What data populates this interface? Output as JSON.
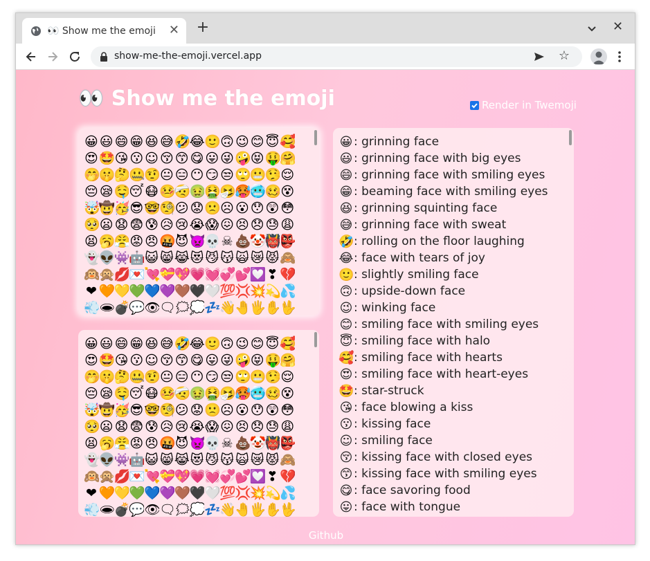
{
  "browser": {
    "tab_title": "👀 Show me the emoji",
    "url": "show-me-the-emoji.vercel.app"
  },
  "page": {
    "title": "👀 Show me the emoji",
    "twemoji_label": "Render in Twemoji",
    "twemoji_checked": true,
    "footer_link": "Github"
  },
  "native_emoji_grid": [
    "😀",
    "😃",
    "😄",
    "😁",
    "😆",
    "😅",
    "🤣",
    "😂",
    "🙂",
    "🙃",
    "😉",
    "😊",
    "😇",
    "🥰",
    "😍",
    "🤩",
    "😘",
    "😗",
    "☺",
    "😚",
    "😙",
    "😋",
    "😛",
    "😜",
    "🤪",
    "😝",
    "🤑",
    "🤗",
    "🤭",
    "🤫",
    "🤔",
    "🤐",
    "🤨",
    "😐",
    "😑",
    "😶",
    "😏",
    "😒",
    "🙄",
    "😬",
    "🤥",
    "😌",
    "😔",
    "😪",
    "🤤",
    "😴",
    "😷",
    "🤒",
    "🤕",
    "🤢",
    "🤮",
    "🤧",
    "🥵",
    "🥶",
    "🥴",
    "😵",
    "🤯",
    "🤠",
    "🥳",
    "😎",
    "🤓",
    "🧐",
    "😕",
    "😟",
    "🙁",
    "☹",
    "😮",
    "😯",
    "😲",
    "😳",
    "🥺",
    "😦",
    "😧",
    "😨",
    "😰",
    "😥",
    "😢",
    "😭",
    "😱",
    "😖",
    "😣",
    "😞",
    "😓",
    "😩",
    "😫",
    "🥱",
    "😤",
    "😡",
    "😠",
    "🤬",
    "😈",
    "👿",
    "💀",
    "☠",
    "💩",
    "🤡",
    "👹",
    "👺",
    "👻",
    "👽",
    "👾",
    "🤖",
    "😺",
    "😸",
    "😹",
    "😻",
    "😼",
    "😽",
    "🙀",
    "😿",
    "😾",
    "🙈",
    "🙉",
    "🙊",
    "💋",
    "💌",
    "💘",
    "💝",
    "💖",
    "💗",
    "💓",
    "💞",
    "💕",
    "💟",
    "❣",
    "💔",
    "❤",
    "🧡",
    "💛",
    "💚",
    "💙",
    "💜",
    "🤎",
    "🖤",
    "🤍",
    "💯",
    "💢",
    "💥",
    "💫",
    "💦",
    "💨",
    "🕳",
    "💣",
    "💬",
    "👁",
    "🗨",
    "🗯",
    "💭",
    "💤",
    "👋",
    "🤚",
    "🖐",
    "✋",
    "🖖",
    "👌",
    "🤏",
    "✌",
    "🤞",
    "🤟",
    "🤘",
    "🤙",
    "👈",
    "👉",
    "👆",
    "🖕",
    "👇",
    "☝",
    "👍",
    "👎",
    "✊",
    "👊",
    "🤛",
    "🤜",
    "👏",
    "🙌",
    "👐",
    "🤲",
    "🤝",
    "🙏"
  ],
  "twemoji_grid": [
    "😀",
    "😃",
    "😄",
    "😁",
    "😆",
    "😅",
    "🤣",
    "😂",
    "🙂",
    "🙃",
    "😉",
    "😊",
    "😇",
    "🥰",
    "😍",
    "🤩",
    "😘",
    "😗",
    "☺",
    "😚",
    "😙",
    "😋",
    "😛",
    "😜",
    "🤪",
    "😝",
    "🤑",
    "🤗",
    "🤭",
    "🤫",
    "🤔",
    "🤐",
    "🤨",
    "😐",
    "😑",
    "😶",
    "😏",
    "😒",
    "🙄",
    "😬",
    "🤥",
    "😌",
    "😔",
    "😪",
    "🤤",
    "😴",
    "😷",
    "🤒",
    "🤕",
    "🤢",
    "🤮",
    "🤧",
    "🥵",
    "🥶",
    "🥴",
    "😵",
    "🤯",
    "🤠",
    "🥳",
    "😎",
    "🤓",
    "🧐",
    "😕",
    "😟",
    "🙁",
    "☹",
    "😮",
    "😯",
    "😲",
    "😳",
    "🥺",
    "😦",
    "😧",
    "😨",
    "😰",
    "😥",
    "😢",
    "😭",
    "😱",
    "😖",
    "😣",
    "😞",
    "😓",
    "😩",
    "😫",
    "🥱",
    "😤",
    "😡",
    "😠",
    "🤬",
    "😈",
    "👿",
    "💀",
    "☠",
    "💩",
    "🤡",
    "👹",
    "👺",
    "👻",
    "👽",
    "👾",
    "🤖",
    "😺",
    "😸",
    "😹",
    "😻",
    "😼",
    "😽",
    "🙀",
    "😿",
    "😾",
    "🙈",
    "🙉",
    "🙊",
    "💋",
    "💌",
    "💘",
    "💝",
    "💖",
    "💗",
    "💓",
    "💞",
    "💕",
    "💟",
    "❣",
    "💔",
    "❤",
    "🧡",
    "💛",
    "💚",
    "💙",
    "💜",
    "🤎",
    "🖤",
    "🤍",
    "💯",
    "💢",
    "💥",
    "💫",
    "💦",
    "💨",
    "🕳",
    "💣",
    "💬",
    "👁",
    "🗨",
    "🗯",
    "💭",
    "💤",
    "👋",
    "🤚",
    "🖐",
    "✋",
    "🖖",
    "👌",
    "🤏",
    "✌",
    "🤞",
    "🤟",
    "🤘",
    "🤙",
    "👈",
    "👉",
    "👆",
    "🖕",
    "👇",
    "☝",
    "👍",
    "👎",
    "✊",
    "👊",
    "🤛",
    "🤜",
    "👏",
    "🙌",
    "👐",
    "🤲",
    "🤝",
    "🙏"
  ],
  "emoji_names": [
    {
      "emoji": "😀",
      "text": ": grinning face"
    },
    {
      "emoji": "😃",
      "text": ": grinning face with big eyes"
    },
    {
      "emoji": "😄",
      "text": ": grinning face with smiling eyes"
    },
    {
      "emoji": "😁",
      "text": ": beaming face with smiling eyes"
    },
    {
      "emoji": "😆",
      "text": ": grinning squinting face"
    },
    {
      "emoji": "😅",
      "text": ": grinning face with sweat"
    },
    {
      "emoji": "🤣",
      "text": ": rolling on the floor laughing"
    },
    {
      "emoji": "😂",
      "text": ": face with tears of joy"
    },
    {
      "emoji": "🙂",
      "text": ": slightly smiling face"
    },
    {
      "emoji": "🙃",
      "text": ": upside-down face"
    },
    {
      "emoji": "😉",
      "text": ": winking face"
    },
    {
      "emoji": "😊",
      "text": ": smiling face with smiling eyes"
    },
    {
      "emoji": "😇",
      "text": ": smiling face with halo"
    },
    {
      "emoji": "🥰",
      "text": ": smiling face with hearts"
    },
    {
      "emoji": "😍",
      "text": ": smiling face with heart-eyes"
    },
    {
      "emoji": "🤩",
      "text": ": star-struck"
    },
    {
      "emoji": "😘",
      "text": ": face blowing a kiss"
    },
    {
      "emoji": "😗",
      "text": ": kissing face"
    },
    {
      "emoji": "☺",
      "text": ": smiling face"
    },
    {
      "emoji": "😚",
      "text": ": kissing face with closed eyes"
    },
    {
      "emoji": "😙",
      "text": ": kissing face with smiling eyes"
    },
    {
      "emoji": "😋",
      "text": ": face savoring food"
    },
    {
      "emoji": "😛",
      "text": ": face with tongue"
    }
  ],
  "colors": {
    "background_start": "#ffb8c9",
    "background_end": "#ffc3e5",
    "panel": "#ffebf0",
    "checkbox": "#1a73e8"
  },
  "icons": [
    "globe-icon",
    "close-icon",
    "plus-icon",
    "chevron-down-icon",
    "back-arrow-icon",
    "forward-arrow-icon",
    "reload-icon",
    "lock-icon",
    "send-icon",
    "star-icon",
    "profile-icon",
    "kebab-menu-icon",
    "checkmark-icon"
  ]
}
